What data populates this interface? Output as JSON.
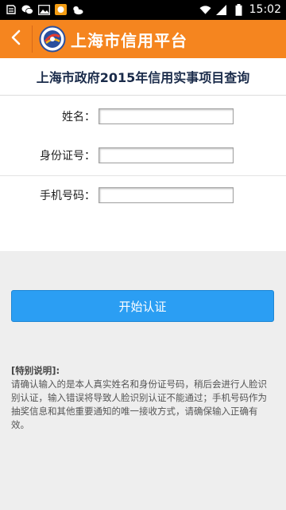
{
  "status_bar": {
    "time": "15:02",
    "left_icons": [
      "notification-icon",
      "wechat-icon",
      "image-icon",
      "game-icon",
      "weather-icon"
    ],
    "right_icons": [
      "wifi-icon",
      "signal-icon",
      "battery-icon"
    ]
  },
  "header": {
    "title": "上海市信用平台",
    "back_icon": "chevron-left-icon",
    "logo_icon": "credit-logo-icon",
    "bg_color": "#f5851f"
  },
  "page": {
    "title": "上海市政府2015年信用实事项目查询"
  },
  "form": {
    "name_label": "姓名：",
    "name_value": "",
    "id_label": "身份证号：",
    "id_value": "",
    "phone_label": "手机号码：",
    "phone_value": ""
  },
  "actions": {
    "start_label": "开始认证",
    "button_color": "#2b9ef3"
  },
  "notice": {
    "title": "[特别说明]:",
    "body": "请确认输入的是本人真实姓名和身份证号码，稍后会进行人脸识别认证，输入错误将导致人脸识别认证不能通过；手机号码作为抽奖信息和其他重要通知的唯一接收方式，请确保输入正确有效。"
  }
}
